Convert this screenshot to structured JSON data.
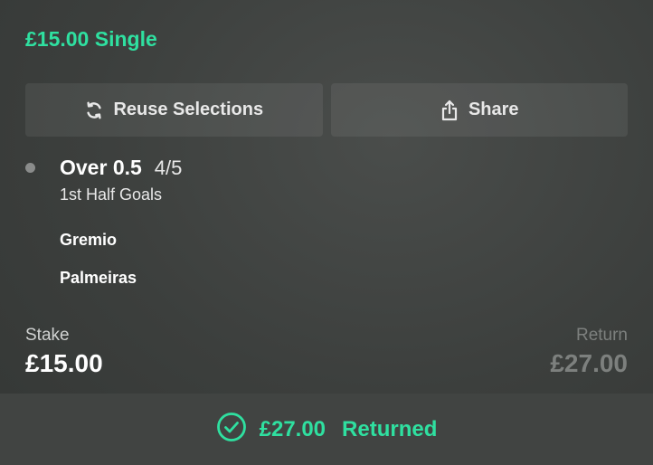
{
  "colors": {
    "accent": "#2fe0a0",
    "muted": "#7d807e"
  },
  "bet": {
    "title": "£15.00 Single"
  },
  "actions": {
    "reuse": {
      "label": "Reuse Selections",
      "icon": "refresh-icon"
    },
    "share": {
      "label": "Share",
      "icon": "share-icon"
    }
  },
  "selection": {
    "name": "Over 0.5",
    "odds": "4/5",
    "market": "1st Half Goals",
    "teams": [
      "Gremio",
      "Palmeiras"
    ]
  },
  "stake": {
    "label": "Stake",
    "value": "£15.00"
  },
  "return": {
    "label": "Return",
    "value": "£27.00"
  },
  "result": {
    "amount": "£27.00",
    "status": "Returned",
    "icon": "check-circle-icon"
  }
}
